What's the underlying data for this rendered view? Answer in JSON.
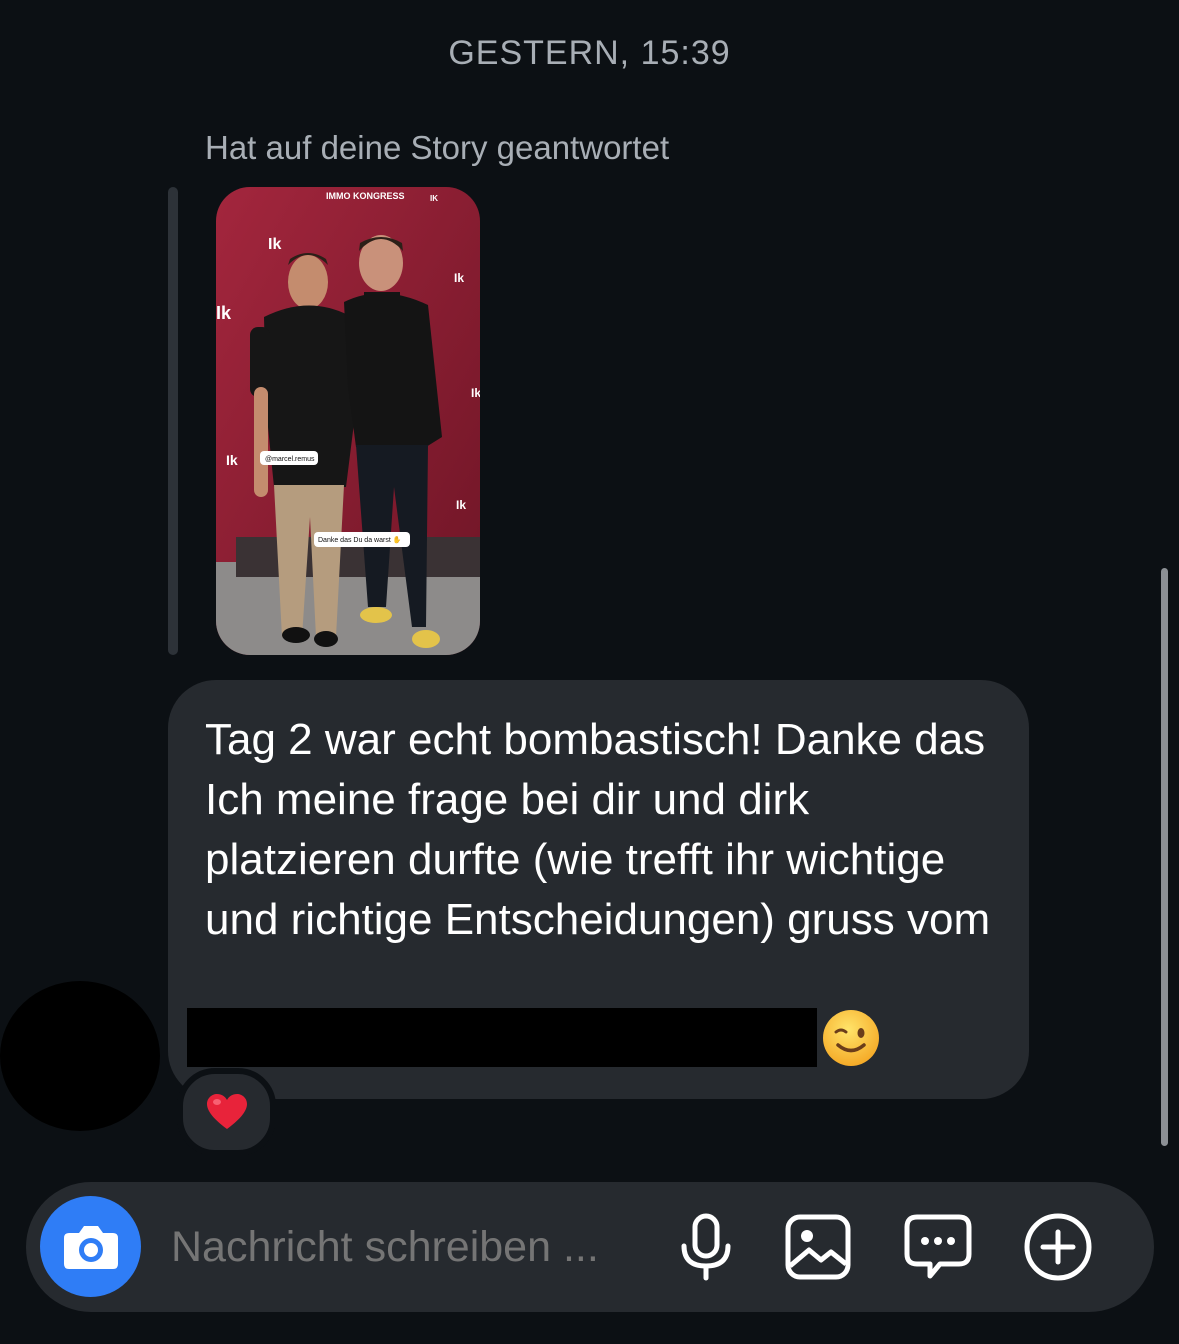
{
  "thread": {
    "timestamp": "GESTERN, 15:39",
    "story_reply_note": "Hat auf deine Story geantwortet"
  },
  "story": {
    "banner_text": "IMMO KONGRESS",
    "sticker_mention": "@marcel.remus",
    "sticker_caption": "Danke das Du da warst ✋"
  },
  "message": {
    "text": "Tag 2 war echt bombastisch! Danke das Ich meine frage bei dir und dirk platzieren durfte (wie trefft ihr wichtige und richtige Entscheidungen) gruss vom",
    "trailing_emoji": "wink-emoji",
    "reaction": "heart"
  },
  "composer": {
    "placeholder": "Nachricht schreiben ...",
    "icons": [
      "camera-icon",
      "microphone-icon",
      "gallery-icon",
      "sticker-chat-icon",
      "plus-icon"
    ]
  },
  "colors": {
    "background": "#0c1014",
    "bubble": "#262a2f",
    "camera_button": "#2f7df6",
    "muted_text": "#a8aeb5"
  }
}
